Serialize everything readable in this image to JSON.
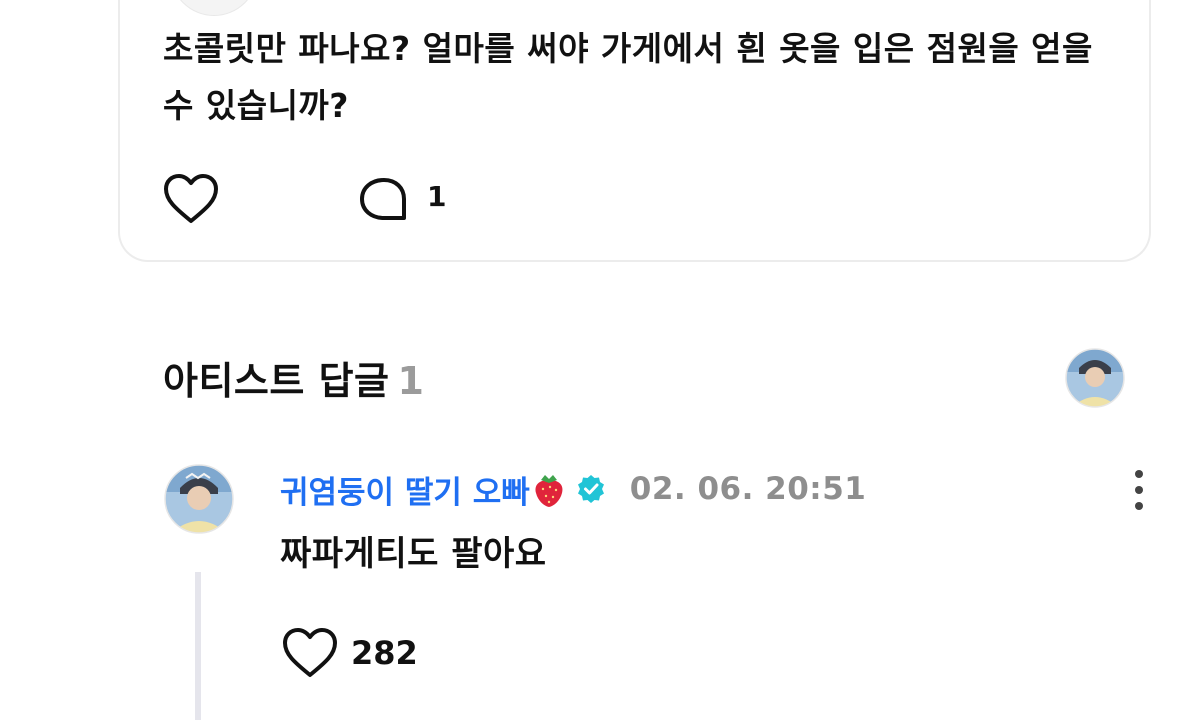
{
  "post": {
    "text": "초콜릿만 파나요? 얼마를 써야 가게에서 흰 옷을 입은 점원을 얻을 수 있습니까?",
    "comment_count": "1",
    "avatar_icon": "plant-figure-avatar"
  },
  "artist_replies": {
    "title": "아티스트 답글",
    "count": "1"
  },
  "reply": {
    "author": "귀염둥이 딸기 오빠",
    "author_emoji_icon": "strawberry-icon",
    "verified_icon": "verified-badge-icon",
    "timestamp": "02. 06. 20:51",
    "text": "짜파게티도 팔아요",
    "like_count": "282"
  },
  "colors": {
    "author_blue": "#1f6ff2",
    "verified_teal": "#21c4d6",
    "muted_gray": "#8e8e8e",
    "thread_line": "#e5e5ec"
  }
}
